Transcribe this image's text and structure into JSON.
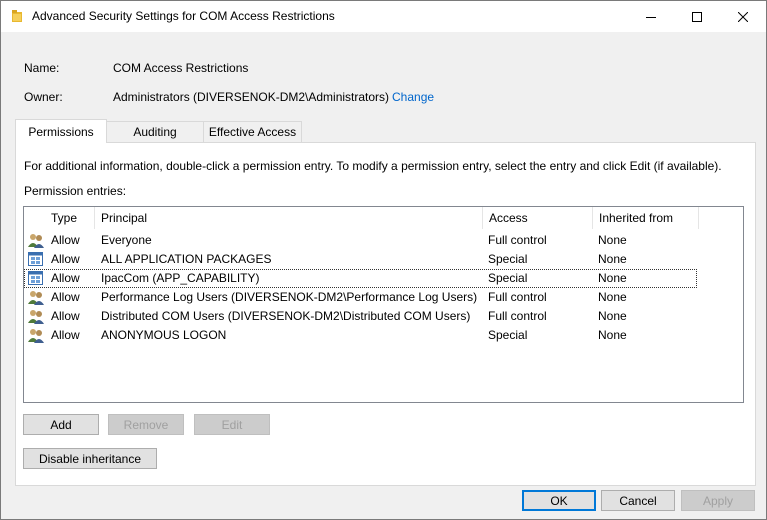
{
  "window": {
    "title": "Advanced Security Settings for COM Access Restrictions"
  },
  "info": {
    "name_label": "Name:",
    "name_value": "COM Access Restrictions",
    "owner_label": "Owner:",
    "owner_value": "Administrators (DIVERSENOK-DM2\\Administrators)",
    "change_link": "Change"
  },
  "tabs": [
    {
      "label": "Permissions",
      "active": true
    },
    {
      "label": "Auditing",
      "active": false
    },
    {
      "label": "Effective Access",
      "active": false
    }
  ],
  "permissions": {
    "info_text": "For additional information, double-click a permission entry. To modify a permission entry, select the entry and click Edit (if available).",
    "entries_label": "Permission entries:",
    "columns": [
      "Type",
      "Principal",
      "Access",
      "Inherited from"
    ],
    "rows": [
      {
        "icon": "user-group-icon",
        "type": "Allow",
        "principal": "Everyone",
        "access": "Full control",
        "inherited": "None"
      },
      {
        "icon": "app-package-icon",
        "type": "Allow",
        "principal": "ALL APPLICATION PACKAGES",
        "access": "Special",
        "inherited": "None"
      },
      {
        "icon": "app-capability-icon",
        "type": "Allow",
        "principal": "IpacCom (APP_CAPABILITY)",
        "access": "Special",
        "inherited": "None"
      },
      {
        "icon": "user-group-icon",
        "type": "Allow",
        "principal": "Performance Log Users (DIVERSENOK-DM2\\Performance Log Users)",
        "access": "Full control",
        "inherited": "None"
      },
      {
        "icon": "user-group-icon",
        "type": "Allow",
        "principal": "Distributed COM Users (DIVERSENOK-DM2\\Distributed COM Users)",
        "access": "Full control",
        "inherited": "None"
      },
      {
        "icon": "user-group-icon",
        "type": "Allow",
        "principal": "ANONYMOUS LOGON",
        "access": "Special",
        "inherited": "None"
      }
    ]
  },
  "buttons": {
    "add": "Add",
    "remove": "Remove",
    "edit": "Edit",
    "disable_inheritance": "Disable inheritance",
    "ok": "OK",
    "cancel": "Cancel",
    "apply": "Apply"
  }
}
